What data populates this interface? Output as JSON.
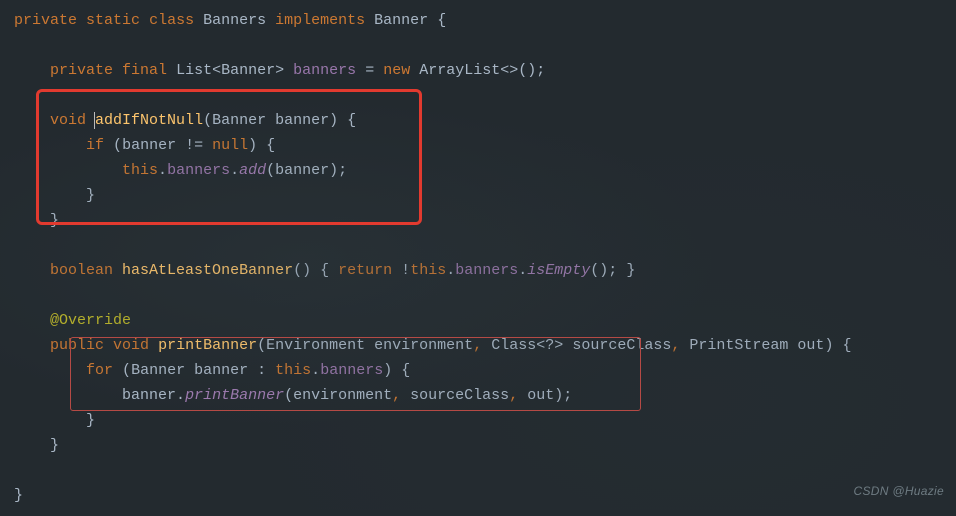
{
  "code": {
    "l1": {
      "kw1": "private",
      "kw2": "static",
      "kw3": "class",
      "cls": "Banners",
      "kw4": "implements",
      "iface": "Banner",
      "ob": "{"
    },
    "l2": {
      "kw1": "private",
      "kw2": "final",
      "type": "List",
      "lt": "<",
      "gen": "Banner",
      "gt": ">",
      "field": "banners",
      "eq": "=",
      "kw3": "new",
      "ctor": "ArrayList",
      "diamond": "<>",
      "parens": "()",
      "semi": ";"
    },
    "l3": {
      "ret": "void",
      "name": "addIfNotNull",
      "lp": "(",
      "ptype": "Banner",
      "pname": "banner",
      "rp": ")",
      "ob": "{"
    },
    "l4": {
      "kw": "if",
      "lp": "(",
      "var": "banner",
      "op": "!=",
      "nul": "null",
      "rp": ")",
      "ob": "{"
    },
    "l5": {
      "this": "this",
      "dot1": ".",
      "field": "banners",
      "dot2": ".",
      "call": "add",
      "lp": "(",
      "arg": "banner",
      "rp": ")",
      "semi": ";"
    },
    "l6": {
      "cb": "}"
    },
    "l7": {
      "cb": "}"
    },
    "l8": {
      "ret": "boolean",
      "name": "hasAtLeastOneBanner",
      "parens": "()",
      "ob": "{",
      "kw": "return",
      "not": "!",
      "this": "this",
      "dot1": ".",
      "field": "banners",
      "dot2": ".",
      "call": "isEmpty",
      "cparen": "()",
      "semi": ";",
      "cb": "}"
    },
    "l9": {
      "anno": "@Override"
    },
    "l10": {
      "kw1": "public",
      "ret": "void",
      "name": "printBanner",
      "lp": "(",
      "t1": "Environment",
      "p1": "environment",
      "c1": ",",
      "t2": "Class",
      "lt": "<",
      "wc": "?",
      "gt": ">",
      "p2": "sourceClass",
      "c2": ",",
      "t3": "PrintStream",
      "p3": "out",
      "rp": ")",
      "ob": "{"
    },
    "l11": {
      "kw": "for",
      "lp": "(",
      "type": "Banner",
      "var": "banner",
      "colon": ":",
      "this": "this",
      "dot": ".",
      "field": "banners",
      "rp": ")",
      "ob": "{"
    },
    "l12": {
      "obj": "banner",
      "dot": ".",
      "call": "printBanner",
      "lp": "(",
      "a1": "environment",
      "c1": ",",
      "a2": "sourceClass",
      "c2": ",",
      "a3": "out",
      "rp": ")",
      "semi": ";"
    },
    "l13": {
      "cb": "}"
    },
    "l14": {
      "cb": "}"
    },
    "l15": {
      "cb": "}"
    }
  },
  "watermark": "CSDN @Huazie"
}
